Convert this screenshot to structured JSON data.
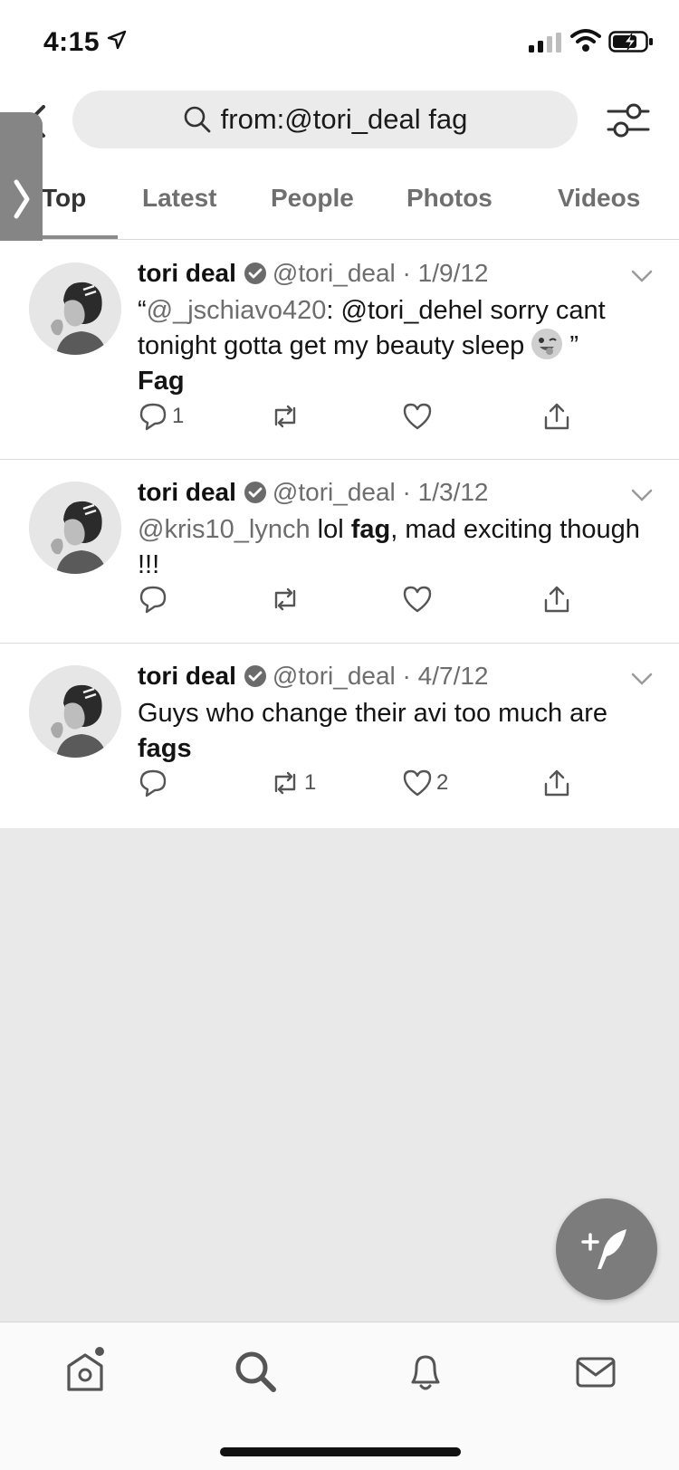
{
  "status_bar": {
    "time": "4:15",
    "icons": [
      "location-arrow-icon",
      "cellular-signal-icon",
      "wifi-icon",
      "battery-charging-icon"
    ]
  },
  "search": {
    "query": "from:@tori_deal fag",
    "icons": [
      "back-icon",
      "search-icon",
      "filter-settings-icon"
    ]
  },
  "tabs": [
    {
      "label": "Top",
      "active": true
    },
    {
      "label": "Latest",
      "active": false
    },
    {
      "label": "People",
      "active": false
    },
    {
      "label": "Photos",
      "active": false
    },
    {
      "label": "Videos",
      "active": false
    }
  ],
  "tweets": [
    {
      "name": "tori deal",
      "handle": "@tori_deal",
      "date": "1/9/12",
      "body": {
        "open_quote": "“",
        "mention1": "@_jschiavo420",
        "text1": ": @tori_dehel sorry cant tonight gotta get my beauty sleep ",
        "emoji": "winking-face-with-tongue-emoji",
        "close_quote": " ”",
        "bold": "Fag"
      },
      "replies": "1",
      "retweets": "",
      "likes": ""
    },
    {
      "name": "tori deal",
      "handle": "@tori_deal",
      "date": "1/3/12",
      "body": {
        "mention1": "@kris10_lynch",
        "text1": " lol ",
        "bold": "fag",
        "text2": ", mad exciting though !!!"
      },
      "replies": "",
      "retweets": "",
      "likes": ""
    },
    {
      "name": "tori deal",
      "handle": "@tori_deal",
      "date": "4/7/12",
      "body": {
        "text1": "Guys who change their avi too much are ",
        "bold": "fags"
      },
      "replies": "",
      "retweets": "1",
      "likes": "2"
    }
  ],
  "bottom_nav": [
    "home-icon",
    "search-icon",
    "notifications-bell-icon",
    "messages-envelope-icon"
  ],
  "fab": "compose-tweet-icon",
  "colors": {
    "background": "#ffffff",
    "empty_area": "#e9e9e9",
    "search_pill": "#ebebeb",
    "muted_text": "#6d6d6d",
    "fab": "#7c7c7c"
  }
}
